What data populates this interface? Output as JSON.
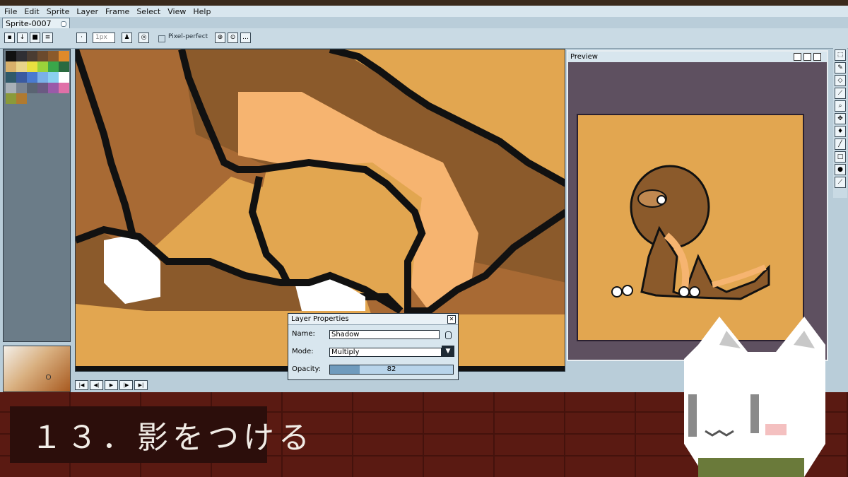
{
  "menu": [
    "File",
    "Edit",
    "Sprite",
    "Layer",
    "Frame",
    "Select",
    "View",
    "Help"
  ],
  "tab": {
    "label": "Sprite-0007"
  },
  "toolbar": {
    "brush_size": "1px",
    "pixel_perfect_label": "Pixel-perfect"
  },
  "palette": {
    "colors": [
      "#111111",
      "#2f2f34",
      "#4a3c32",
      "#6b4a2d",
      "#8b5a2b",
      "#e08a2a",
      "#d8b06a",
      "#e8d48a",
      "#e8e040",
      "#9ad33a",
      "#3aa64a",
      "#2a6a40",
      "#305a6a",
      "#3a5aa0",
      "#4a7ad0",
      "#7ab0e8",
      "#8ad0f0",
      "#ffffff",
      "#a8b0b8",
      "#7a8490",
      "#5a6472",
      "#6a5a82",
      "#9a5aa8",
      "#e070a8",
      "#8a9a3a",
      "#b07a30"
    ]
  },
  "preview": {
    "title": "Preview"
  },
  "layer_properties": {
    "title": "Layer Properties",
    "name_label": "Name:",
    "name_value": "Shadow",
    "mode_label": "Mode:",
    "mode_value": "Multiply",
    "opacity_label": "Opacity:",
    "opacity_value": "82",
    "opacity_fraction": 0.24
  },
  "caption": "１３．影をつける",
  "colors": {
    "canvas_bg": "#e2a650",
    "ui_bg": "#b9cdd9",
    "bottom_bg": "#5a1a12",
    "caption_box": "#2c0e0b"
  }
}
